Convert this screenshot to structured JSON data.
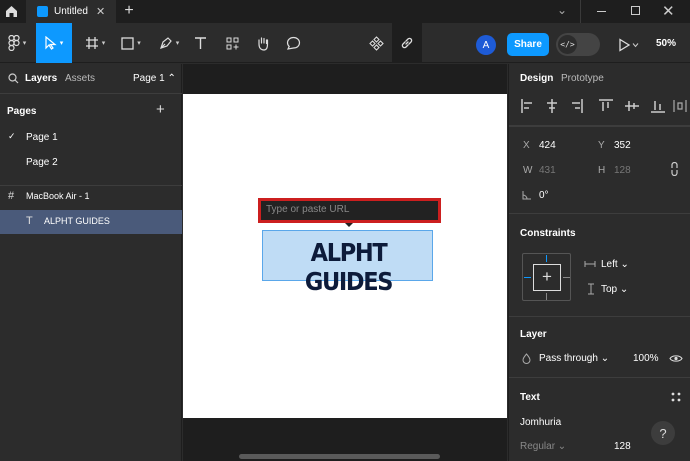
{
  "titlebar": {
    "tab_title": "Untitled",
    "close_glyph": "✕",
    "new_tab_glyph": "+",
    "menu_glyph": "⌄",
    "close_window_glyph": "✕"
  },
  "toolbar": {
    "avatar_initial": "A",
    "share_label": "Share",
    "dev_mode_glyph": "</>",
    "zoom": "50%",
    "icons": [
      "figma-menu-icon",
      "move-tool-icon",
      "frame-tool-icon",
      "rectangle-tool-icon",
      "pen-tool-icon",
      "text-tool-icon",
      "resources-icon",
      "hand-tool-icon",
      "comment-tool-icon",
      "component-icon",
      "link-icon",
      "play-icon"
    ],
    "accent": "#0d99ff"
  },
  "left_panel": {
    "tabs": {
      "layers": "Layers",
      "assets": "Assets",
      "page_selector": "Page 1 ⌃"
    },
    "pages_heading": "Pages",
    "add_glyph": "+",
    "pages": [
      {
        "name": "Page 1",
        "current": true,
        "check": "✓"
      },
      {
        "name": "Page 2",
        "current": false,
        "check": ""
      }
    ],
    "layers": [
      {
        "name": "MacBook Air - 1",
        "icon": "#",
        "selected": false
      },
      {
        "name": "ALPHT GUIDES",
        "icon": "T",
        "selected": true
      }
    ]
  },
  "canvas": {
    "url_placeholder": "Type or paste URL",
    "text_layer": "ALPHT GUIDES",
    "highlight_color": "#cc1f1f"
  },
  "right_panel": {
    "tabs": {
      "design": "Design",
      "prototype": "Prototype"
    },
    "position": {
      "x_label": "X",
      "x": "424",
      "y_label": "Y",
      "y": "352"
    },
    "size": {
      "w_label": "W",
      "w": "431",
      "h_label": "H",
      "h": "128"
    },
    "rotation": "0°",
    "constraints": {
      "heading": "Constraints",
      "horizontal": "Left ⌄",
      "vertical": "Top ⌄"
    },
    "layer": {
      "heading": "Layer",
      "blend": "Pass through ⌄",
      "opacity": "100%"
    },
    "text": {
      "heading": "Text",
      "font": "Jomhuria",
      "weight": "Regular ⌄",
      "size": "128"
    },
    "help_glyph": "?"
  }
}
